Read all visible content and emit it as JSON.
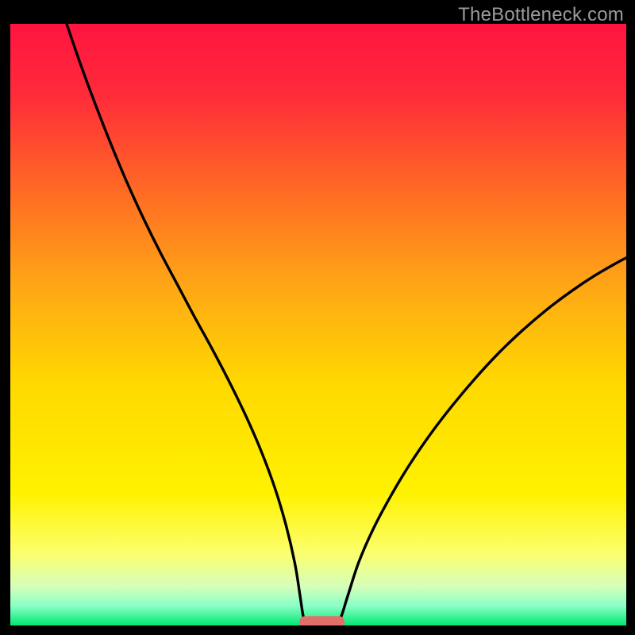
{
  "attribution": "TheBottleneck.com",
  "chart_data": {
    "type": "line",
    "title": "",
    "xlabel": "",
    "ylabel": "",
    "xlim": [
      0,
      100
    ],
    "ylim": [
      0,
      100
    ],
    "gradient_stops": [
      {
        "offset": 0.0,
        "color": "#ff1440"
      },
      {
        "offset": 0.12,
        "color": "#ff2c3a"
      },
      {
        "offset": 0.28,
        "color": "#ff6b24"
      },
      {
        "offset": 0.44,
        "color": "#ffa815"
      },
      {
        "offset": 0.6,
        "color": "#ffd900"
      },
      {
        "offset": 0.78,
        "color": "#fff200"
      },
      {
        "offset": 0.88,
        "color": "#fcff6e"
      },
      {
        "offset": 0.935,
        "color": "#d6ffba"
      },
      {
        "offset": 0.968,
        "color": "#88ffc6"
      },
      {
        "offset": 1.0,
        "color": "#00e770"
      }
    ],
    "series": [
      {
        "name": "left-curve",
        "points": [
          {
            "x": 9.14,
            "y": 100.0
          },
          {
            "x": 11.5,
            "y": 93.0
          },
          {
            "x": 14.0,
            "y": 86.1
          },
          {
            "x": 16.5,
            "y": 79.6
          },
          {
            "x": 19.0,
            "y": 73.5
          },
          {
            "x": 21.6,
            "y": 67.7
          },
          {
            "x": 24.3,
            "y": 62.1
          },
          {
            "x": 27.1,
            "y": 56.7
          },
          {
            "x": 29.9,
            "y": 51.3
          },
          {
            "x": 32.8,
            "y": 45.9
          },
          {
            "x": 35.6,
            "y": 40.4
          },
          {
            "x": 38.3,
            "y": 34.7
          },
          {
            "x": 40.8,
            "y": 28.8
          },
          {
            "x": 43.0,
            "y": 22.7
          },
          {
            "x": 44.8,
            "y": 16.5
          },
          {
            "x": 46.2,
            "y": 10.3
          },
          {
            "x": 47.0,
            "y": 5.2
          },
          {
            "x": 47.5,
            "y": 1.8
          },
          {
            "x": 47.85,
            "y": 0.5
          }
        ]
      },
      {
        "name": "right-curve",
        "points": [
          {
            "x": 53.35,
            "y": 0.5
          },
          {
            "x": 53.9,
            "y": 2.0
          },
          {
            "x": 54.9,
            "y": 5.3
          },
          {
            "x": 56.6,
            "y": 10.6
          },
          {
            "x": 58.9,
            "y": 16.0
          },
          {
            "x": 61.7,
            "y": 21.4
          },
          {
            "x": 64.8,
            "y": 26.7
          },
          {
            "x": 68.2,
            "y": 31.8
          },
          {
            "x": 71.8,
            "y": 36.6
          },
          {
            "x": 75.5,
            "y": 41.1
          },
          {
            "x": 79.3,
            "y": 45.3
          },
          {
            "x": 83.2,
            "y": 49.1
          },
          {
            "x": 87.1,
            "y": 52.5
          },
          {
            "x": 91.0,
            "y": 55.5
          },
          {
            "x": 94.8,
            "y": 58.1
          },
          {
            "x": 98.5,
            "y": 60.3
          },
          {
            "x": 100.0,
            "y": 61.1
          }
        ]
      }
    ],
    "marker": {
      "name": "optimal-zone",
      "x_start": 47.85,
      "x_end": 53.35,
      "y": 0.6,
      "color": "#e26f67",
      "thickness_pct": 1.9
    }
  }
}
